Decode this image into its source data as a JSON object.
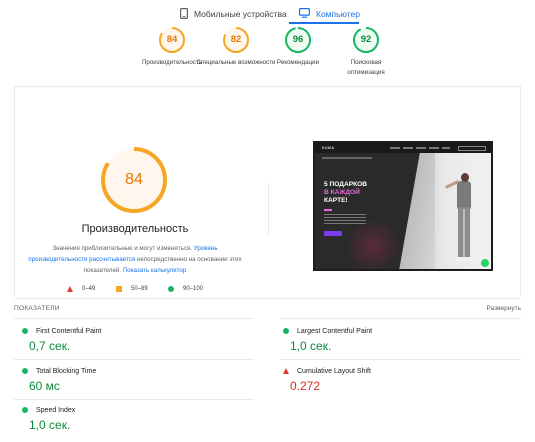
{
  "tabs": {
    "mobile_label": "Мобильные устройства",
    "desktop_label": "Компьютер",
    "active": "desktop"
  },
  "gauges": [
    {
      "score": "84",
      "label": "Производительность",
      "color": "#f5a623",
      "text_color": "#e67700",
      "fraction": 0.84
    },
    {
      "score": "82",
      "label": "Специальные возможности",
      "color": "#f5a623",
      "text_color": "#e67700",
      "fraction": 0.82
    },
    {
      "score": "96",
      "label": "Рекомендации",
      "color": "#18b663",
      "text_color": "#0c8a3a",
      "fraction": 0.96
    },
    {
      "score": "92",
      "label": "Поисковая оптимизация",
      "color": "#18b663",
      "text_color": "#0c8a3a",
      "fraction": 0.92
    }
  ],
  "performance": {
    "score": "84",
    "fraction": 0.84,
    "title": "Производительность",
    "desc_prefix": "Значения приблизительные и могут изменяться. ",
    "desc_link1": "Уровень производительности рассчитывается",
    "desc_middle": " непосредственно на основании этих показателей. ",
    "desc_link2": "Показать калькулятор"
  },
  "legend": {
    "bad": "0–49",
    "average": "50–89",
    "good": "90–100"
  },
  "preview": {
    "logo": "KUMA",
    "headline_line1": "5 ПОДАРКОВ",
    "headline_line2": "В КАЖДОЙ",
    "headline_line3": "КАРТЕ!"
  },
  "metrics": {
    "section_title": "ПОКАЗАТЕЛИ",
    "expand_label": "Развернуть",
    "items": [
      {
        "name": "First Contentful Paint",
        "value": "0,7 сек.",
        "status": "good"
      },
      {
        "name": "Largest Contentful Paint",
        "value": "1,0 сек.",
        "status": "good"
      },
      {
        "name": "Total Blocking Time",
        "value": "60 мс",
        "status": "good"
      },
      {
        "name": "Cumulative Layout Shift",
        "value": "0.272",
        "status": "bad"
      },
      {
        "name": "Speed Index",
        "value": "1,0 сек.",
        "status": "good"
      }
    ]
  },
  "colors": {
    "accent": "#1a73e8",
    "good": "#18b663",
    "average": "#f5a623",
    "bad": "#e53935"
  }
}
